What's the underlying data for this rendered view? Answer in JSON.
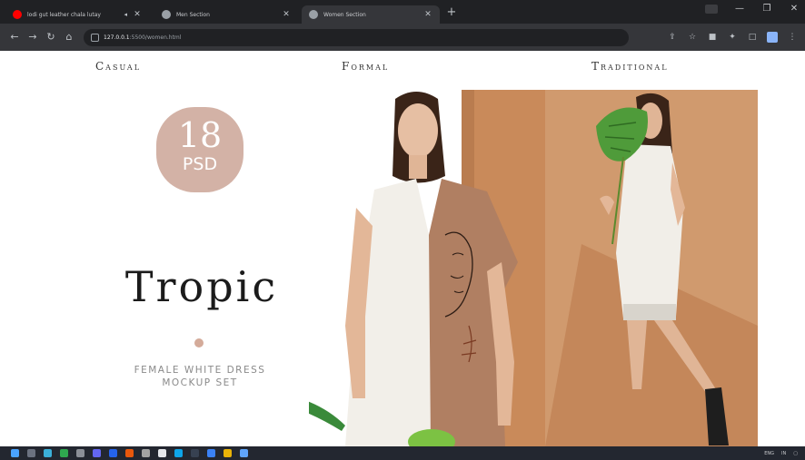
{
  "browser": {
    "tabs": [
      {
        "label": "lodi gut leather chala lutay",
        "favicon_color": "#ff0000",
        "active": false
      },
      {
        "label": "Men Section",
        "favicon_color": "#9aa0a6",
        "active": false
      },
      {
        "label": "Women Section",
        "favicon_color": "#9aa0a6",
        "active": true
      }
    ],
    "new_tab": "+",
    "window_controls": [
      "—",
      "❐",
      "✕"
    ],
    "nav": {
      "back": "←",
      "forward": "→",
      "reload": "↻",
      "home": "⌂"
    },
    "url": {
      "host": "127.0.0.1",
      "path": ":5500/women.html"
    },
    "toolbar_icons": [
      "share-icon",
      "star-icon",
      "bookmark-icon",
      "extensions-icon",
      "tab-search-icon",
      "profile-icon",
      "menu-icon"
    ]
  },
  "nav": {
    "categories": [
      "Casual",
      "Formal",
      "Traditional"
    ]
  },
  "hero": {
    "badge_number": "18",
    "badge_unit": "PSD",
    "brand": "Tropic",
    "subtitle_line1": "FEMALE WHITE DRESS",
    "subtitle_line2": "MOCKUP SET"
  },
  "taskbar": {
    "icons": [
      "windows-icon",
      "search-icon",
      "edge-icon",
      "chrome-icon",
      "store-icon",
      "file-explorer-icon",
      "mail-icon",
      "office-icon",
      "vscode-icon",
      "github-icon",
      "settings-icon",
      "terminal-icon",
      "folder-icon",
      "photos-icon"
    ],
    "tray_lang": "ENG",
    "tray_region": "IN"
  },
  "colors": {
    "badge": "#d3b2a6",
    "photo_bg": "#c98a5a",
    "accent_dot": "#d4ab9a"
  }
}
